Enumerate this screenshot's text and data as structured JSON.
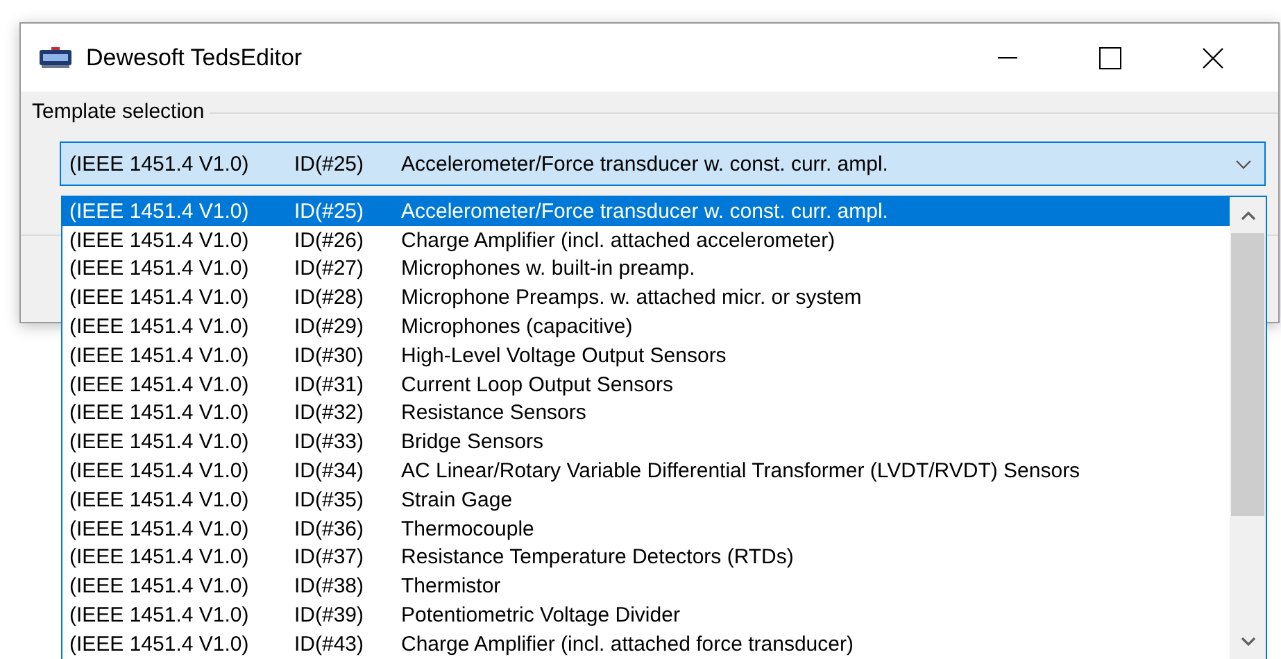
{
  "window": {
    "title": "Dewesoft TedsEditor"
  },
  "group": {
    "label": "Template selection"
  },
  "combo": {
    "version": "(IEEE 1451.4 V1.0)",
    "id": "ID(#25)",
    "description": "Accelerometer/Force transducer w. const. curr. ampl.",
    "expanded": true
  },
  "dropdown": {
    "items": [
      {
        "version": "(IEEE 1451.4 V1.0)",
        "id": "ID(#25)",
        "description": "Accelerometer/Force transducer w. const. curr. ampl.",
        "selected": true
      },
      {
        "version": "(IEEE 1451.4 V1.0)",
        "id": "ID(#26)",
        "description": "Charge Amplifier (incl. attached accelerometer)",
        "selected": false
      },
      {
        "version": "(IEEE 1451.4 V1.0)",
        "id": "ID(#27)",
        "description": "Microphones w. built-in preamp.",
        "selected": false
      },
      {
        "version": "(IEEE 1451.4 V1.0)",
        "id": "ID(#28)",
        "description": "Microphone Preamps. w. attached micr. or system",
        "selected": false
      },
      {
        "version": "(IEEE 1451.4 V1.0)",
        "id": "ID(#29)",
        "description": "Microphones (capacitive)",
        "selected": false
      },
      {
        "version": "(IEEE 1451.4 V1.0)",
        "id": "ID(#30)",
        "description": "High-Level Voltage Output Sensors",
        "selected": false
      },
      {
        "version": "(IEEE 1451.4 V1.0)",
        "id": "ID(#31)",
        "description": "Current Loop Output Sensors",
        "selected": false
      },
      {
        "version": "(IEEE 1451.4 V1.0)",
        "id": "ID(#32)",
        "description": "Resistance Sensors",
        "selected": false
      },
      {
        "version": "(IEEE 1451.4 V1.0)",
        "id": "ID(#33)",
        "description": "Bridge Sensors",
        "selected": false
      },
      {
        "version": "(IEEE 1451.4 V1.0)",
        "id": "ID(#34)",
        "description": "AC Linear/Rotary Variable Differential Transformer (LVDT/RVDT) Sensors",
        "selected": false
      },
      {
        "version": "(IEEE 1451.4 V1.0)",
        "id": "ID(#35)",
        "description": "Strain Gage",
        "selected": false
      },
      {
        "version": "(IEEE 1451.4 V1.0)",
        "id": "ID(#36)",
        "description": "Thermocouple",
        "selected": false
      },
      {
        "version": "(IEEE 1451.4 V1.0)",
        "id": "ID(#37)",
        "description": "Resistance Temperature Detectors (RTDs)",
        "selected": false
      },
      {
        "version": "(IEEE 1451.4 V1.0)",
        "id": "ID(#38)",
        "description": "Thermistor",
        "selected": false
      },
      {
        "version": "(IEEE 1451.4 V1.0)",
        "id": "ID(#39)",
        "description": "Potentiometric Voltage Divider",
        "selected": false
      },
      {
        "version": "(IEEE 1451.4 V1.0)",
        "id": "ID(#43)",
        "description": "Charge Amplifier (incl. attached force transducer)",
        "selected": false
      }
    ]
  }
}
